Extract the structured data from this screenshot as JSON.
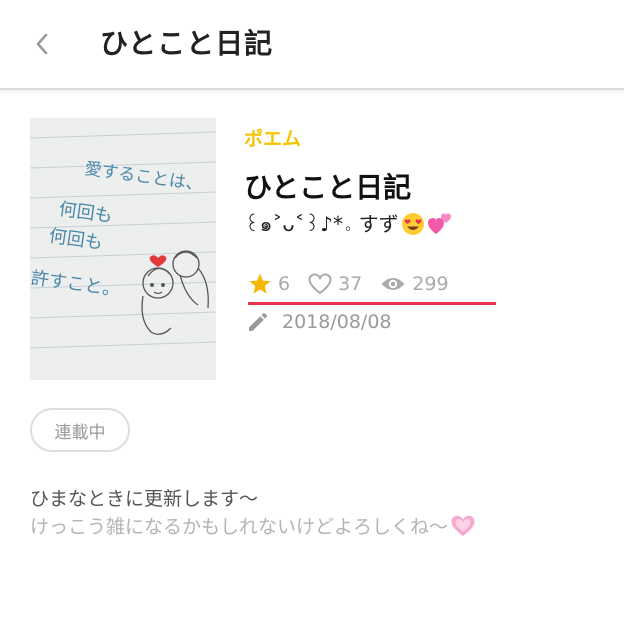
{
  "header": {
    "back_icon": "chevron-left-icon",
    "title": "ひとこと日記"
  },
  "story": {
    "cover_image": {
      "handwriting_lines": [
        "愛することは、",
        "何回も",
        "何回も",
        "許すこと。"
      ]
    },
    "genre": "ポエム",
    "title": "ひとこと日記",
    "subtitle_text": "꒰๑˃ᴗ˂꒱♪*。すず",
    "subtitle_emojis": [
      "heart-eyes-emoji",
      "two-hearts-emoji"
    ],
    "stats": {
      "stars": "6",
      "likes": "37",
      "views": "299"
    },
    "date": "2018/08/08",
    "status_badge": "連載中"
  },
  "description": {
    "line1": "ひまなときに更新します〜",
    "line2": "けっこう雑になるかもしれないけどよろしくね〜",
    "line2_emoji": "pink-heart-emoji"
  },
  "colors": {
    "genre": "#f5c400",
    "star": "#f5b800",
    "underline": "#e8344a",
    "muted_text": "#aaaaaa"
  }
}
